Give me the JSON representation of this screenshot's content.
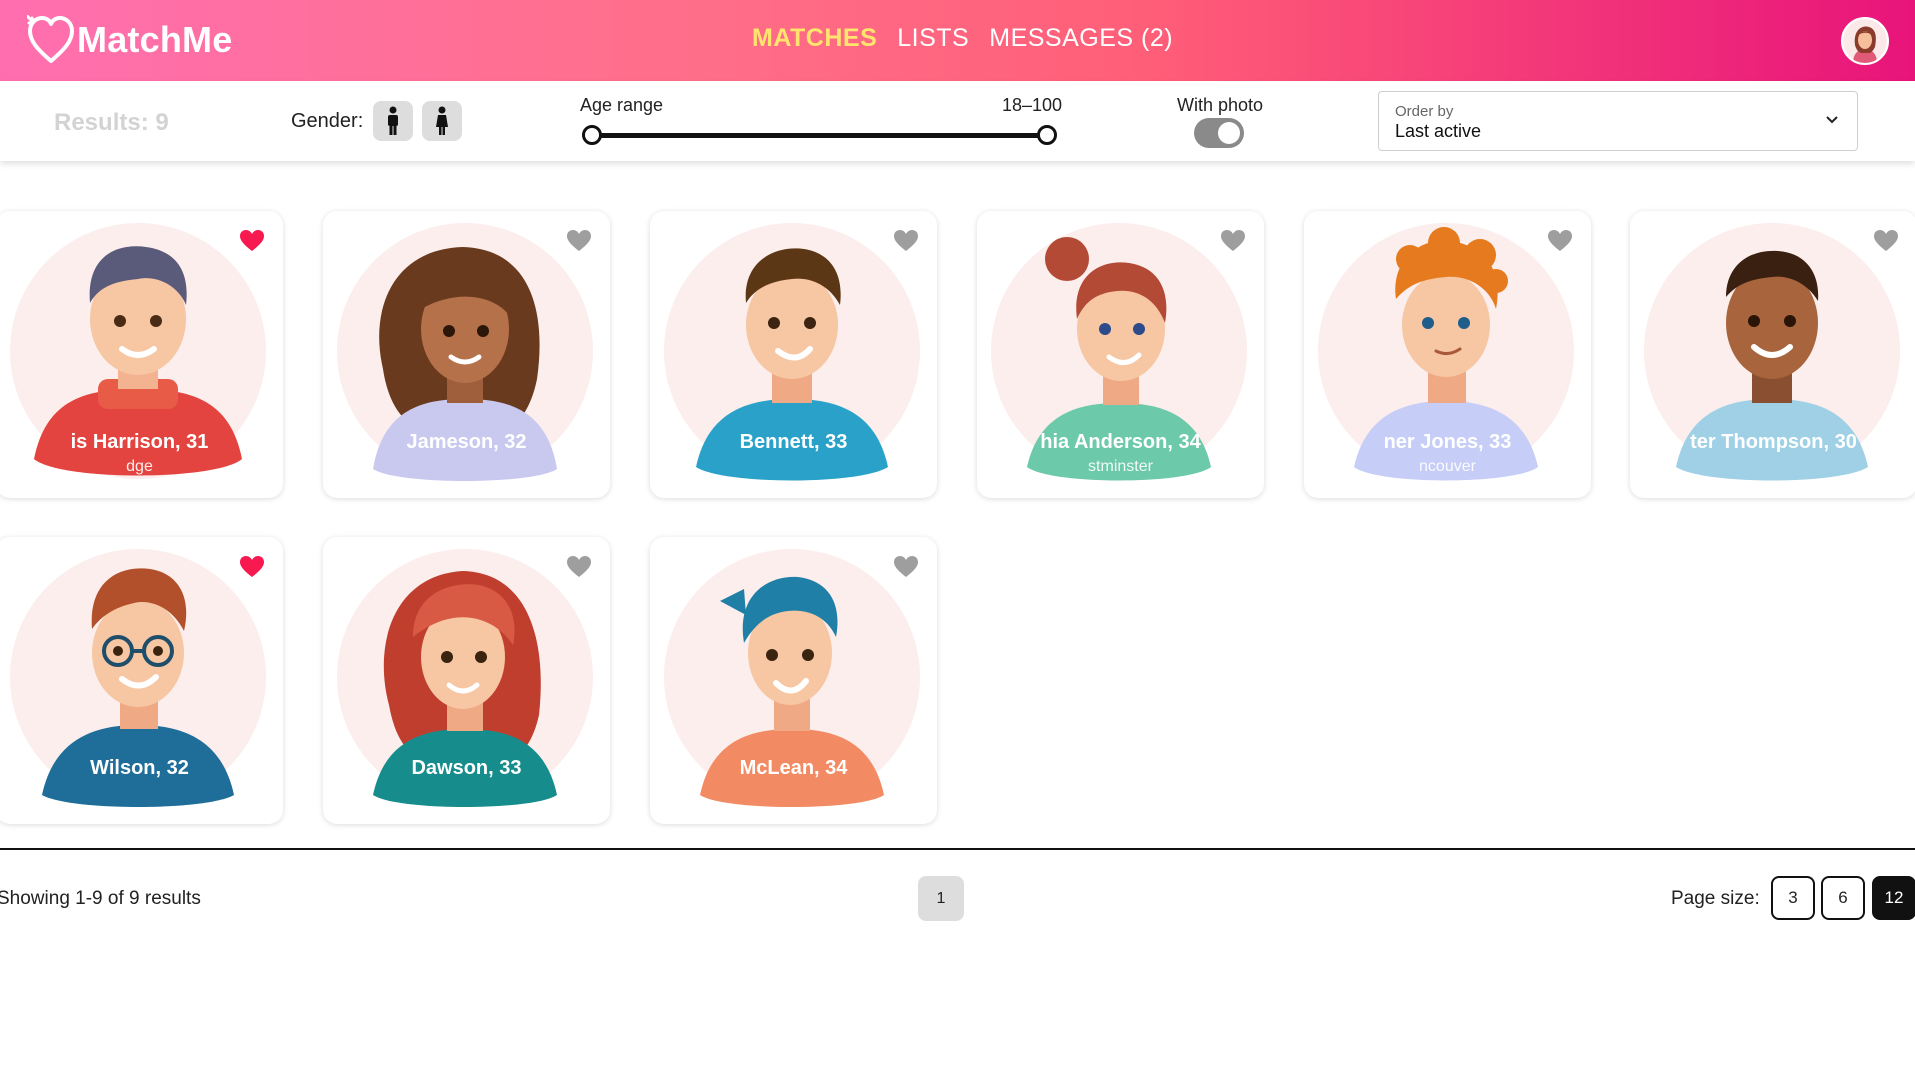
{
  "app": {
    "name": "MatchMe"
  },
  "nav": {
    "items": [
      {
        "label": "MATCHES",
        "active": true
      },
      {
        "label": "LISTS",
        "active": false
      },
      {
        "label": "MESSAGES (2)",
        "active": false
      }
    ]
  },
  "filters": {
    "results": "Results: 9",
    "gender_label": "Gender:",
    "gender_options": [
      "male-icon",
      "female-icon"
    ],
    "age_label": "Age range",
    "age_value": "18–100",
    "age_min": 18,
    "age_max": 100,
    "with_photo_label": "With photo",
    "with_photo_on": true,
    "order_label": "Order by",
    "order_value": "Last active"
  },
  "cards": [
    {
      "name": "is Harrison, 31",
      "city": "dge",
      "favorite": true
    },
    {
      "name": "Jameson, 32",
      "city": "",
      "favorite": false
    },
    {
      "name": "Bennett, 33",
      "city": "",
      "favorite": false
    },
    {
      "name": "hia Anderson, 34",
      "city": "stminster",
      "favorite": false
    },
    {
      "name": "ner Jones, 33",
      "city": "ncouver",
      "favorite": false
    },
    {
      "name": "ter Thompson, 30",
      "city": "",
      "favorite": false
    },
    {
      "name": "Wilson, 32",
      "city": "",
      "favorite": true
    },
    {
      "name": "Dawson, 33",
      "city": "",
      "favorite": false
    },
    {
      "name": "McLean, 34",
      "city": "",
      "favorite": false
    }
  ],
  "footer": {
    "showing": "Showing 1-9 of 9 results",
    "pages": [
      "1"
    ],
    "page_size_label": "Page size:",
    "page_sizes": [
      "3",
      "6",
      "12"
    ],
    "selected_page_size": "12"
  },
  "colors": {
    "favorite": "#f7194f",
    "favorite_off": "#9e9e9e",
    "accent": "#ffe46e"
  }
}
